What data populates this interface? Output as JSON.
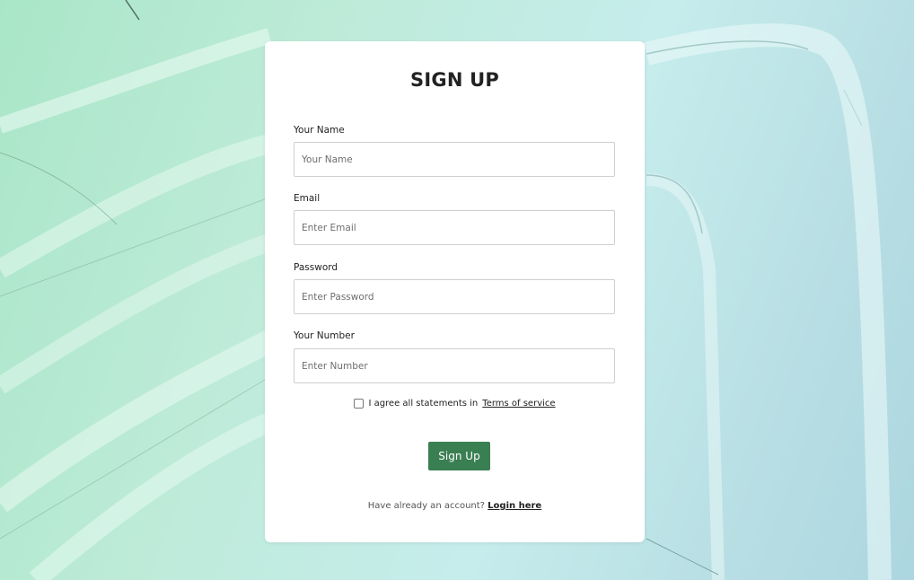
{
  "form": {
    "title": "SIGN UP",
    "fields": [
      {
        "label": "Your Name",
        "placeholder": "Your Name"
      },
      {
        "label": "Email",
        "placeholder": "Enter Email"
      },
      {
        "label": "Password",
        "placeholder": "Enter Password"
      },
      {
        "label": "Your Number",
        "placeholder": "Enter Number"
      }
    ],
    "terms_text": "I agree all statements in",
    "terms_link": "Terms of service",
    "submit_label": "Sign Up",
    "login_prompt": "Have already an account?",
    "login_link": "Login here"
  },
  "colors": {
    "button": "#3a7f52",
    "card": "#ffffff"
  }
}
